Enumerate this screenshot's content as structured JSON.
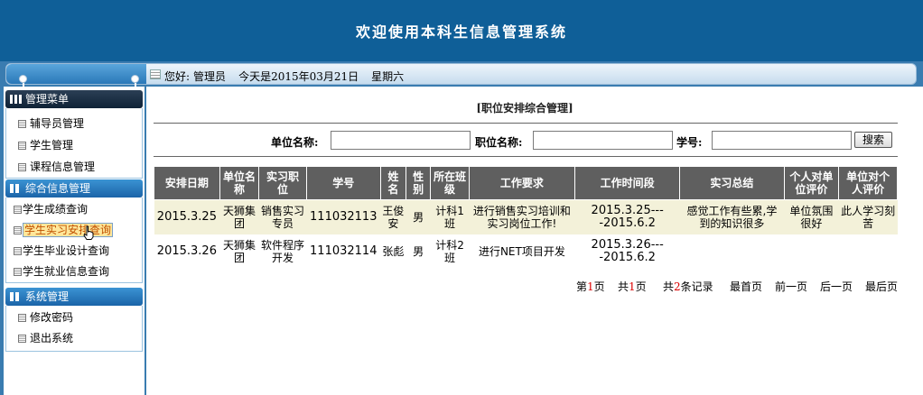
{
  "header": {
    "title": "欢迎使用本科生信息管理系统"
  },
  "infobar": {
    "greeting": "您好:",
    "user": "管理员",
    "date_text": "今天是2015年03月21日",
    "weekday": "星期六"
  },
  "sidebar": {
    "groups": [
      {
        "title": "管理菜单",
        "items": [
          "辅导员管理",
          "学生管理",
          "课程信息管理"
        ]
      },
      {
        "title": "综合信息管理",
        "items": [
          "学生成绩查询",
          "学生实习安排查询",
          "学生毕业设计查询",
          "学生就业信息查询"
        ],
        "active_index": 1
      },
      {
        "title": "系统管理",
        "items": [
          "修改密码",
          "退出系统"
        ]
      }
    ]
  },
  "main": {
    "title": "[职位安排综合管理]",
    "search": {
      "unit_label": "单位名称:",
      "position_label": "职位名称:",
      "student_id_label": "学号:",
      "unit_value": "",
      "position_value": "",
      "student_id_value": "",
      "button_label": "搜索"
    },
    "table": {
      "headers": [
        "安排日期",
        "单位名称",
        "实习职位",
        "学号",
        "姓名",
        "性别",
        "所在班级",
        "工作要求",
        "工作时间段",
        "实习总结",
        "个人对单位评价",
        "单位对个人评价"
      ],
      "rows": [
        [
          "2015.3.25",
          "天狮集团",
          "销售实习专员",
          "111032113",
          "王俊安",
          "男",
          "计科1班",
          "进行销售实习培训和实习岗位工作!",
          "2015.3.25----2015.6.2",
          "感觉工作有些累,学到的知识很多",
          "单位氛围很好",
          "此人学习刻苦"
        ],
        [
          "2015.3.26",
          "天狮集团",
          "软件程序开发",
          "111032114",
          "张彪",
          "男",
          "计科2班",
          "进行NET项目开发",
          "2015.3.26----2015.6.2",
          "",
          "",
          ""
        ]
      ]
    },
    "pager": {
      "page_prefix": "第",
      "page_current": "1",
      "page_suffix": "页",
      "total_prefix": "共",
      "total_pages": "1",
      "total_suffix": "页",
      "records_prefix": "共",
      "records_count": "2",
      "records_suffix": "条记录",
      "first": "最首页",
      "prev": "前一页",
      "next": "后一页",
      "last": "最后页"
    }
  },
  "colors": {
    "header_bg": "#0f5f98",
    "table_header_bg": "#5f5f5f",
    "row_highlight": "#f3f1d9",
    "accent_red": "#dd0000"
  }
}
